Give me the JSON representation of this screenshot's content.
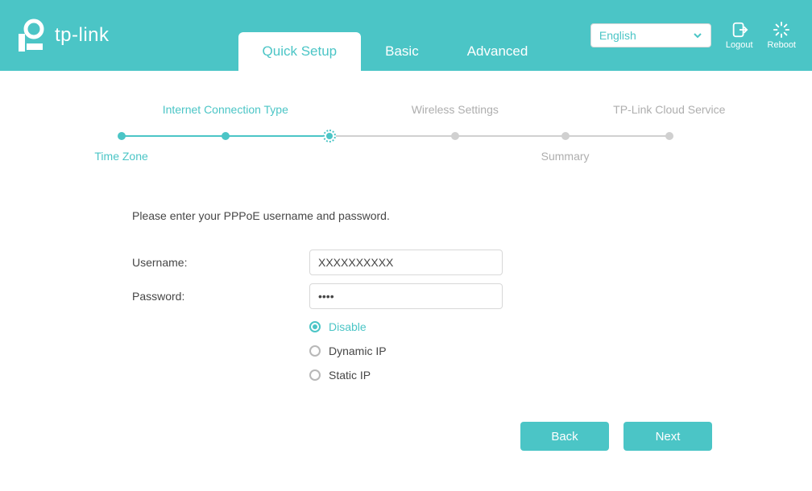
{
  "header": {
    "brand": "tp-link",
    "tabs": [
      {
        "label": "Quick Setup",
        "active": true
      },
      {
        "label": "Basic",
        "active": false
      },
      {
        "label": "Advanced",
        "active": false
      }
    ],
    "language": "English",
    "logout_label": "Logout",
    "reboot_label": "Reboot"
  },
  "stepper": {
    "steps": [
      {
        "label": "Time Zone",
        "position": "bottom",
        "state": "done"
      },
      {
        "label": "Internet Connection Type",
        "position": "top",
        "state": "current"
      },
      {
        "label": "Wireless Settings",
        "position": "top",
        "state": "pending"
      },
      {
        "label": "Summary",
        "position": "bottom",
        "state": "pending"
      },
      {
        "label": "TP-Link Cloud Service",
        "position": "top",
        "state": "pending"
      }
    ]
  },
  "form": {
    "prompt": "Please enter your PPPoE username and password.",
    "username_label": "Username:",
    "username_value": "XXXXXXXXXX",
    "password_label": "Password:",
    "password_value": "••••",
    "options": [
      {
        "label": "Disable",
        "selected": true
      },
      {
        "label": "Dynamic IP",
        "selected": false
      },
      {
        "label": "Static IP",
        "selected": false
      }
    ]
  },
  "buttons": {
    "back": "Back",
    "next": "Next"
  }
}
